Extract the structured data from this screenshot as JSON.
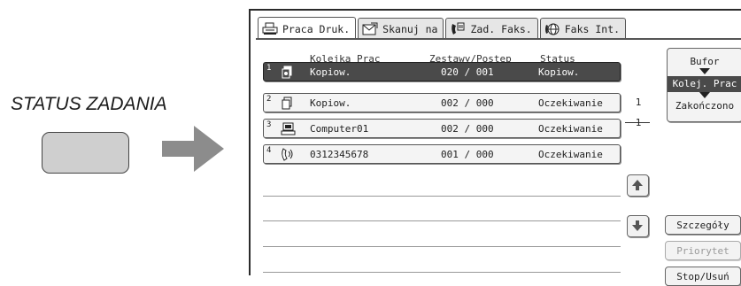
{
  "illustration": {
    "label": "STATUS ZADANIA"
  },
  "tabs": [
    {
      "label": "Praca Druk.",
      "icon": "printer-icon",
      "active": true
    },
    {
      "label": "Skanuj na",
      "icon": "scanner-icon",
      "active": false
    },
    {
      "label": "Zad. Faks.",
      "icon": "fax-icon",
      "active": false
    },
    {
      "label": "Faks Int.",
      "icon": "internet-fax-icon",
      "active": false
    }
  ],
  "columns": {
    "queue": "Kolejka Prac",
    "progress": "Zestawy/Postęp",
    "status": "Status"
  },
  "jobs": [
    {
      "num": "1",
      "icon": "copy-icon",
      "name": "Kopiow.",
      "progress": "020 / 001",
      "status": "Kopiow.",
      "selected": true
    },
    {
      "num": "2",
      "icon": "copy-icon",
      "name": "Kopiow.",
      "progress": "002 / 000",
      "status": "Oczekiwanie",
      "selected": false
    },
    {
      "num": "3",
      "icon": "computer-icon",
      "name": "Computer01",
      "progress": "002 / 000",
      "status": "Oczekiwanie",
      "selected": false
    },
    {
      "num": "4",
      "icon": "phone-icon",
      "name": "0312345678",
      "progress": "001 / 000",
      "status": "Oczekiwanie",
      "selected": false
    }
  ],
  "pagination": {
    "current": "1",
    "total": "1"
  },
  "side": {
    "spool": "Bufor",
    "queue": "Kolej. Prac",
    "complete": "Zakończono",
    "details": "Szczegóły",
    "priority": "Priorytet",
    "stop_delete": "Stop/Usuń"
  }
}
